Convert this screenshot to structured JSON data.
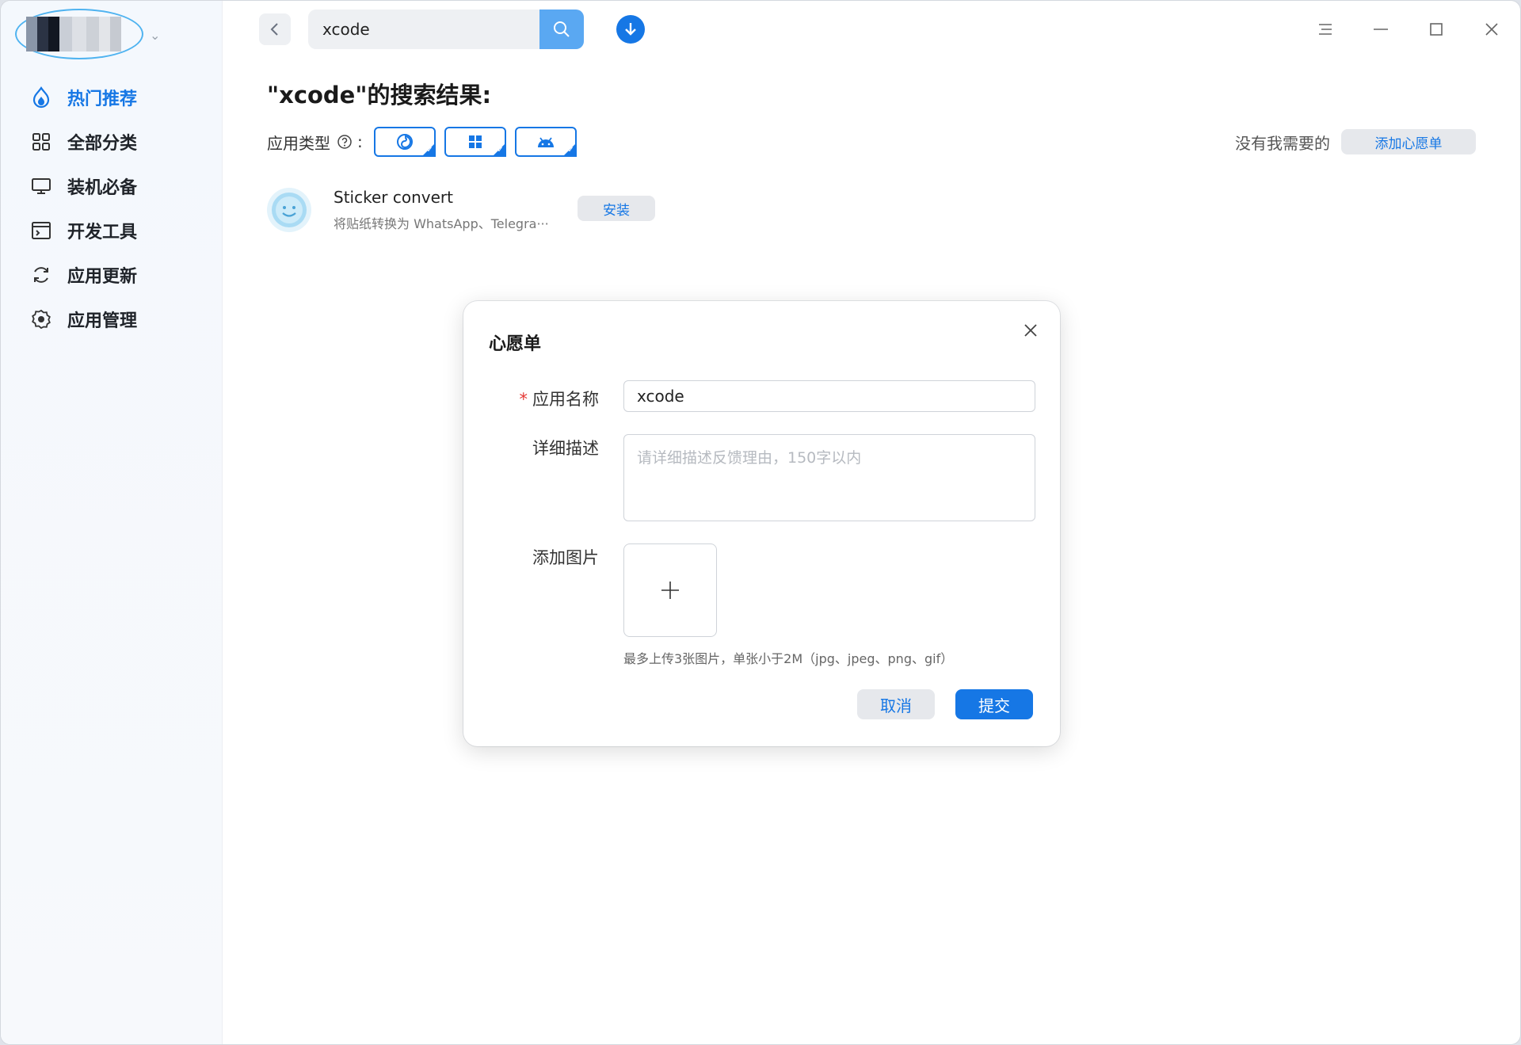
{
  "sidebar": {
    "items": [
      {
        "label": "热门推荐",
        "icon": "flame-icon",
        "active": true
      },
      {
        "label": "全部分类",
        "icon": "grid-icon",
        "active": false
      },
      {
        "label": "装机必备",
        "icon": "monitor-icon",
        "active": false
      },
      {
        "label": "开发工具",
        "icon": "terminal-icon",
        "active": false
      },
      {
        "label": "应用更新",
        "icon": "refresh-icon",
        "active": false
      },
      {
        "label": "应用管理",
        "icon": "gear-icon",
        "active": false
      }
    ]
  },
  "topbar": {
    "search_value": "xcode"
  },
  "main": {
    "result_title": "\"xcode\"的搜索结果:",
    "filter_label": "应用类型",
    "filter_colon": ":",
    "wish_prompt": "没有我需要的",
    "wish_button": "添加心愿单",
    "app": {
      "name": "Sticker convert",
      "description": "将贴纸转换为 WhatsApp、Telegra···",
      "install_label": "安装"
    }
  },
  "dialog": {
    "title": "心愿单",
    "name_label": "应用名称",
    "name_required_mark": "*",
    "name_value": "xcode",
    "desc_label": "详细描述",
    "desc_placeholder": "请详细描述反馈理由，150字以内",
    "image_label": "添加图片",
    "upload_hint": "最多上传3张图片，单张小于2M（jpg、jpeg、png、gif）",
    "cancel_label": "取消",
    "submit_label": "提交"
  },
  "colors": {
    "accent": "#1677e5",
    "required": "#e53935"
  }
}
